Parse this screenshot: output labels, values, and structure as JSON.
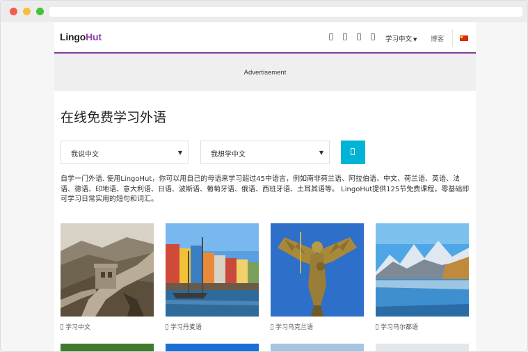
{
  "header": {
    "logo_lingo": "Lingo",
    "logo_hut": "Hut",
    "nav_learn": "学习中文",
    "nav_caret": "▼",
    "nav_blog": "博客"
  },
  "ad": {
    "label": "Advertisement"
  },
  "main": {
    "title": "在线免费学习外语",
    "select_speak": "我说中文",
    "select_learn": "我想学中文",
    "select_caret": "▼",
    "description": "自学一门外语. 使用LingoHut，你可以用自己的母语来学习超过45中语言，例如南非荷兰语、阿拉伯语、中文、荷兰语、英语、法语、德语、印地语、意大利语、日语、波斯语、葡萄牙语、俄语、西班牙语、土耳其语等。 LingoHut提供125节免费课程，零基础即可学习日常实用的短句和词汇。"
  },
  "cards": [
    {
      "label": "学习中文"
    },
    {
      "label": "学习丹麦语"
    },
    {
      "label": "学习乌克兰语"
    },
    {
      "label": "学习乌尔都语"
    }
  ],
  "colors": {
    "brand_purple": "#8e44ad",
    "button_cyan": "#00b4d8",
    "flag_red": "#de2910"
  }
}
